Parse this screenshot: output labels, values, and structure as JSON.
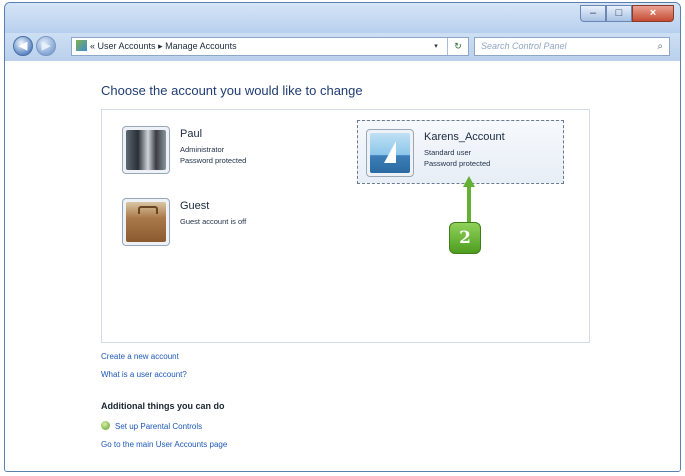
{
  "window": {
    "caption_buttons": {
      "minimize": "–",
      "maximize": "□",
      "close": "×"
    }
  },
  "navbar": {
    "back_glyph": "◀",
    "forward_glyph": "▶",
    "address_prefix": "«",
    "breadcrumb_root": "User Accounts",
    "breadcrumb_sep": "▸",
    "breadcrumb_current": "Manage Accounts",
    "dropdown_glyph": "▾",
    "refresh_glyph": "↻",
    "search_placeholder": "Search Control Panel",
    "search_icon": "⌕"
  },
  "main": {
    "heading": "Choose the account you would like to change",
    "accounts": [
      {
        "name": "Paul",
        "line1": "Administrator",
        "line2": "Password protected",
        "icon": "people-photo-icon"
      },
      {
        "name": "Karens_Account",
        "line1": "Standard user",
        "line2": "Password protected",
        "icon": "sailboat-icon",
        "selected": true
      },
      {
        "name": "Guest",
        "line1": "Guest account is off",
        "line2": "",
        "icon": "briefcase-icon"
      }
    ],
    "step_number": "2",
    "links": {
      "create": "Create a new account",
      "what_is": "What is a user account?"
    },
    "additional": {
      "heading": "Additional things you can do",
      "parental": "Set up Parental Controls",
      "main_page": "Go to the main User Accounts page"
    }
  },
  "colors": {
    "accent_green": "#62b132",
    "link_blue": "#1d58b7",
    "heading_blue": "#1f3c73"
  }
}
